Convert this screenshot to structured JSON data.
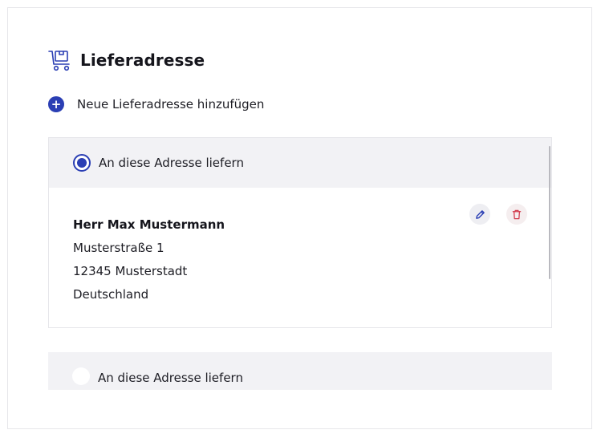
{
  "section": {
    "title": "Lieferadresse",
    "icon": "delivery-cart-icon"
  },
  "add_address": {
    "label": "Neue Lieferadresse hinzufügen",
    "icon": "plus-circle-icon"
  },
  "addresses": [
    {
      "radio_label": "An diese Adresse liefern",
      "selected": true,
      "name": "Herr Max Mustermann",
      "street": "Musterstraße 1",
      "city": "12345 Musterstadt",
      "country": "Deutschland",
      "actions": [
        "edit-icon",
        "delete-icon"
      ]
    },
    {
      "radio_label": "An diese Adresse liefern",
      "selected": false
    }
  ],
  "colors": {
    "accent": "#2b3fb4",
    "danger": "#d23b4c",
    "bar_bg": "#f2f2f5"
  }
}
